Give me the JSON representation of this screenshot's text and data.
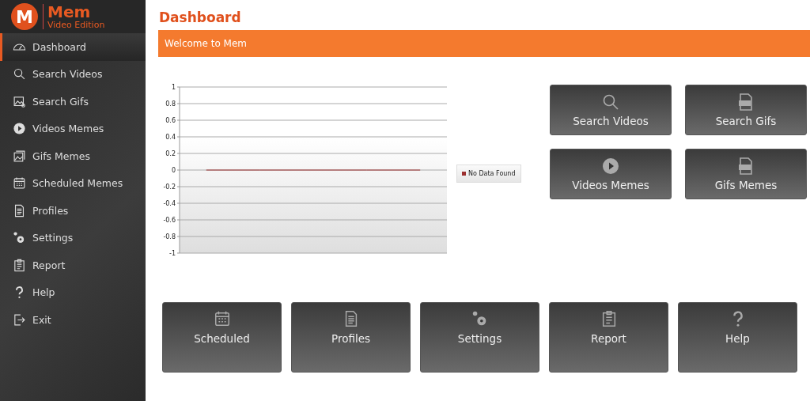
{
  "app": {
    "logo_letter": "M",
    "name": "Mem",
    "edition": "Video Edition"
  },
  "sidebar": {
    "items": [
      {
        "label": "Dashboard",
        "selected": true
      },
      {
        "label": "Search Videos",
        "selected": false
      },
      {
        "label": "Search Gifs",
        "selected": false
      },
      {
        "label": "Videos Memes",
        "selected": false
      },
      {
        "label": "Gifs Memes",
        "selected": false
      },
      {
        "label": "Scheduled Memes",
        "selected": false
      },
      {
        "label": "Profiles",
        "selected": false
      },
      {
        "label": "Settings",
        "selected": false
      },
      {
        "label": "Report",
        "selected": false
      },
      {
        "label": "Help",
        "selected": false
      },
      {
        "label": "Exit",
        "selected": false
      }
    ]
  },
  "page_title": "Dashboard",
  "banner": "Welcome to Mem",
  "chart": {
    "chart_data": {
      "type": "line",
      "grid": true,
      "categories": [
        null,
        null,
        null,
        null,
        null
      ],
      "ylim": [
        -1,
        1
      ],
      "yticks": [
        1,
        0.8,
        0.6,
        0.4,
        0.2,
        0,
        -0.2,
        -0.4,
        -0.6,
        -0.8,
        -1
      ],
      "series": [
        {
          "name": "No Data Found",
          "color": "#9b2f2f",
          "values": [
            0,
            0,
            0,
            0,
            0
          ]
        }
      ]
    }
  },
  "quick_tiles": [
    {
      "label": "Search Videos"
    },
    {
      "label": "Search Gifs"
    },
    {
      "label": "Videos Memes"
    },
    {
      "label": "Gifs Memes"
    }
  ],
  "bottom_tiles": [
    {
      "label": "Scheduled"
    },
    {
      "label": "Profiles"
    },
    {
      "label": "Settings"
    },
    {
      "label": "Report"
    },
    {
      "label": "Help"
    }
  ]
}
